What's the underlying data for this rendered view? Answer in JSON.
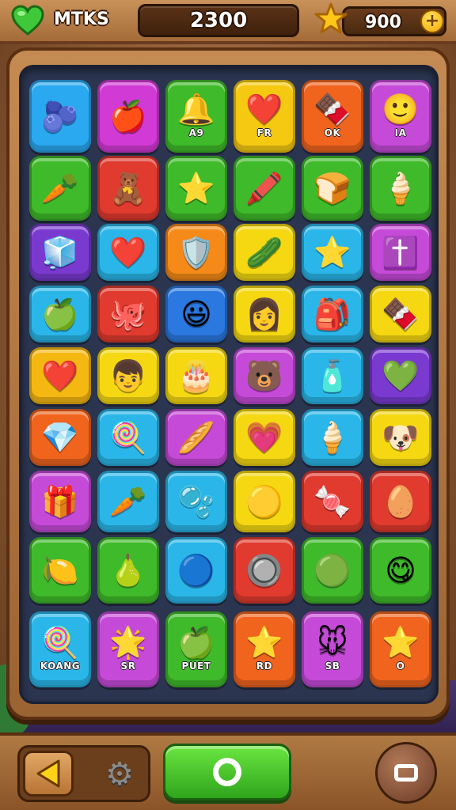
{
  "header": {
    "title": "MTKS",
    "score": "2300",
    "coins": "900",
    "add_coins": "+",
    "heart_icon": "heart-icon",
    "star_icon": "star-icon"
  },
  "board": {
    "rows": [
      [
        {
          "item": "🫐",
          "color": "#2aa8f0",
          "label": ""
        },
        {
          "item": "🍎",
          "color": "#d23ad6",
          "label": ""
        },
        {
          "item": "🔔",
          "color": "#3fba2a",
          "label": "A9"
        },
        {
          "item": "❤️",
          "color": "#f5c912",
          "label": "FR"
        },
        {
          "item": "🍫",
          "color": "#f0641e",
          "label": "OK"
        },
        {
          "item": "🙂",
          "color": "#c64ad8",
          "label": "IA"
        }
      ],
      [
        {
          "item": "🥕",
          "color": "#3fba2a",
          "label": ""
        },
        {
          "item": "🧸",
          "color": "#e13a2e",
          "label": ""
        },
        {
          "item": "⭐",
          "color": "#3fba2a",
          "label": ""
        },
        {
          "item": "🖍️",
          "color": "#3fba2a",
          "label": ""
        },
        {
          "item": "🍞",
          "color": "#3fba2a",
          "label": ""
        },
        {
          "item": "🍦",
          "color": "#3fba2a",
          "label": ""
        }
      ],
      [
        {
          "item": "🧊",
          "color": "#7a3ad0",
          "label": ""
        },
        {
          "item": "❤️",
          "color": "#2ab6e8",
          "label": ""
        },
        {
          "item": "🛡️",
          "color": "#f58a18",
          "label": ""
        },
        {
          "item": "🥒",
          "color": "#f5d812",
          "label": ""
        },
        {
          "item": "⭐",
          "color": "#2ab6e8",
          "label": ""
        },
        {
          "item": "✝️",
          "color": "#c64ad8",
          "label": ""
        }
      ],
      [
        {
          "item": "🍏",
          "color": "#2ab6e8",
          "label": ""
        },
        {
          "item": "🐙",
          "color": "#e13a2e",
          "label": ""
        },
        {
          "item": "😃",
          "color": "#2a78e0",
          "label": ""
        },
        {
          "item": "👩",
          "color": "#f5d812",
          "label": ""
        },
        {
          "item": "🎒",
          "color": "#2ab6e8",
          "label": ""
        },
        {
          "item": "🍫",
          "color": "#f5d812",
          "label": ""
        }
      ],
      [
        {
          "item": "❤️",
          "color": "#f5b812",
          "label": ""
        },
        {
          "item": "👦",
          "color": "#f5d812",
          "label": ""
        },
        {
          "item": "🎂",
          "color": "#f5d812",
          "label": ""
        },
        {
          "item": "🐻",
          "color": "#c64ad8",
          "label": ""
        },
        {
          "item": "🧴",
          "color": "#2ab6e8",
          "label": ""
        },
        {
          "item": "💚",
          "color": "#7a3ad0",
          "label": ""
        }
      ],
      [
        {
          "item": "💎",
          "color": "#f0641e",
          "label": ""
        },
        {
          "item": "🍭",
          "color": "#2ab6e8",
          "label": ""
        },
        {
          "item": "🥖",
          "color": "#c64ad8",
          "label": ""
        },
        {
          "item": "💗",
          "color": "#f5d812",
          "label": ""
        },
        {
          "item": "🍦",
          "color": "#2ab6e8",
          "label": ""
        },
        {
          "item": "🐶",
          "color": "#f5d812",
          "label": ""
        }
      ],
      [
        {
          "item": "🎁",
          "color": "#c64ad8",
          "label": ""
        },
        {
          "item": "🥕",
          "color": "#2ab6e8",
          "label": ""
        },
        {
          "item": "🫧",
          "color": "#2ab6e8",
          "label": ""
        },
        {
          "item": "🟡",
          "color": "#f5d812",
          "label": ""
        },
        {
          "item": "🍬",
          "color": "#e13a2e",
          "label": ""
        },
        {
          "item": "🥚",
          "color": "#e13a2e",
          "label": ""
        }
      ],
      [
        {
          "item": "🍋",
          "color": "#3fba2a",
          "label": ""
        },
        {
          "item": "🍐",
          "color": "#3fba2a",
          "label": ""
        },
        {
          "item": "🔵",
          "color": "#2ab6e8",
          "label": ""
        },
        {
          "item": "🔘",
          "color": "#e13a2e",
          "label": ""
        },
        {
          "item": "🟢",
          "color": "#3fba2a",
          "label": ""
        },
        {
          "item": "😋",
          "color": "#3fba2a",
          "label": ""
        }
      ],
      [
        {
          "item": "🍭",
          "color": "#2ab6e8",
          "label": "KOANG"
        },
        {
          "item": "🌟",
          "color": "#c64ad8",
          "label": "SR"
        },
        {
          "item": "🍏",
          "color": "#3fba2a",
          "label": "PUET"
        },
        {
          "item": "⭐",
          "color": "#f0641e",
          "label": "RD"
        },
        {
          "item": "🐭",
          "color": "#c64ad8",
          "label": "SB"
        },
        {
          "item": "⭐",
          "color": "#f0641e",
          "label": "O"
        }
      ]
    ]
  },
  "footer": {
    "back_icon": "back-arrow-icon",
    "settings_icon": "gear-icon",
    "settings_glyph": "⚙",
    "play_icon": "play-ring-icon",
    "menu_icon": "menu-square-icon"
  }
}
